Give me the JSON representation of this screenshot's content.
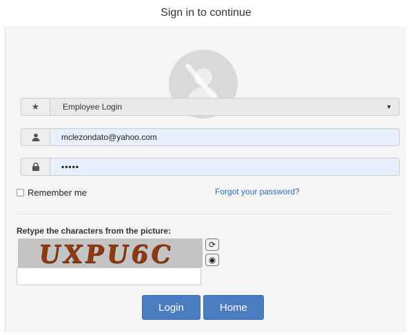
{
  "page": {
    "title": "Sign in to continue"
  },
  "login_type": {
    "icon": "star-icon",
    "selected": "Employee Login"
  },
  "username": {
    "icon": "user-icon",
    "value": "mclezondato@yahoo.com"
  },
  "password": {
    "icon": "lock-icon",
    "value": "•••••"
  },
  "remember": {
    "label": "Remember me",
    "checked": false
  },
  "forgot": {
    "label": "Forgot your password?"
  },
  "captcha": {
    "label": "Retype the characters from the picture:",
    "image_text": "UXPU6C",
    "refresh_icon": "refresh-icon",
    "audio_icon": "audio-icon",
    "input_value": ""
  },
  "buttons": {
    "login": "Login",
    "home": "Home"
  },
  "colors": {
    "button": "#4a7dbf",
    "link": "#2a6ebb",
    "autofill": "#e8f0fe",
    "captcha_text": "#8b3a12"
  }
}
